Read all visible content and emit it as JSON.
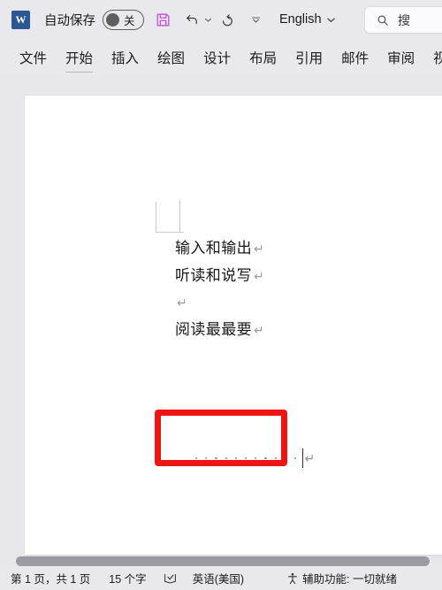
{
  "titlebar": {
    "app_icon": "word-icon",
    "app_icon_letter": "W",
    "autosave_label": "自动保存",
    "autosave_state": "关",
    "save_icon": "save-floppy-icon",
    "undo_icon": "undo-icon",
    "undo_dropdown_icon": "chevron-down-icon",
    "redo_icon": "redo-icon",
    "qat_more_icon": "chevron-down-icon",
    "language_label": "English",
    "language_chevron_icon": "chevron-down-icon"
  },
  "search": {
    "icon": "search-icon",
    "text": "搜"
  },
  "ribbon": {
    "tabs": [
      {
        "label": "文件",
        "active": false
      },
      {
        "label": "开始",
        "active": true
      },
      {
        "label": "插入",
        "active": false
      },
      {
        "label": "绘图",
        "active": false
      },
      {
        "label": "设计",
        "active": false
      },
      {
        "label": "布局",
        "active": false
      },
      {
        "label": "引用",
        "active": false
      },
      {
        "label": "邮件",
        "active": false
      },
      {
        "label": "审阅",
        "active": false
      },
      {
        "label": "视图",
        "active": false
      }
    ]
  },
  "document": {
    "lines": [
      {
        "text": "输入和输出",
        "pilcrow": "↵"
      },
      {
        "text": "听读和说写",
        "pilcrow": "↵"
      },
      {
        "text": "",
        "pilcrow": "↵"
      },
      {
        "text": "阅读最最要",
        "pilcrow": "↵"
      }
    ],
    "highlight": {
      "color": "#f01414",
      "space_dot_count": 11,
      "end_pilcrow": "↵"
    }
  },
  "statusbar": {
    "pages": "第 1 页，共 1 页",
    "words": "15 个字",
    "proofing_icon": "proofing-book-icon",
    "language": "英语(美国)",
    "accessibility_icon": "accessibility-person-icon",
    "accessibility_text": "辅助功能: 一切就绪"
  }
}
